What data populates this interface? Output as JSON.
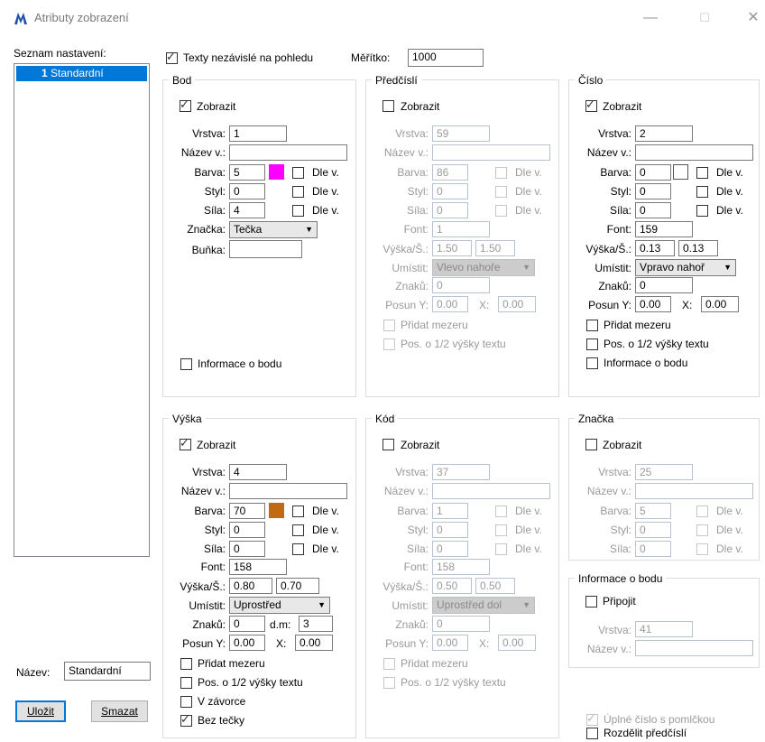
{
  "window": {
    "title": "Atributy zobrazení"
  },
  "left": {
    "list_label": "Seznam nastavení:",
    "list_items": [
      {
        "num": "1",
        "name": "Standardní"
      }
    ],
    "name_label": "Název:",
    "name_value": "Standardní",
    "save": "Uložit",
    "delete": "Smazat"
  },
  "top": {
    "independent_label": "Texty nezávislé na pohledu",
    "independent_checked": true,
    "scale_label": "Měřítko:",
    "scale_value": "1000"
  },
  "labels": {
    "show": "Zobrazit",
    "layer": "Vrstva:",
    "layer_name": "Název v.:",
    "color": "Barva:",
    "style": "Styl:",
    "weight": "Síla:",
    "by_layer": "Dle v.",
    "font": "Font:",
    "height_width": "Výška/Š.:",
    "place": "Umístit:",
    "chars": "Znaků:",
    "offset_y": "Posun Y:",
    "x": "X:",
    "add_space": "Přidat mezeru",
    "half_shift": "Pos. o 1/2 výšky textu",
    "point_info": "Informace o bodu",
    "mark": "Značka:",
    "cell": "Buňka:",
    "dm": "d.m:",
    "brackets": "V závorce",
    "no_dot": "Bez tečky",
    "attach": "Připojit"
  },
  "groups": {
    "bod": {
      "title": "Bod",
      "show": true,
      "layer": "1",
      "layer_name": "",
      "color": "5",
      "color_hex": "#ff00ff",
      "style": "0",
      "weight": "4",
      "mark": "Tečka",
      "cell": "",
      "point_info": false
    },
    "predcisli": {
      "title": "Předčíslí",
      "show": false,
      "layer": "59",
      "layer_name": "",
      "color": "86",
      "style": "0",
      "weight": "0",
      "font": "1",
      "h": "1.50",
      "w": "1.50",
      "place": "Vlevo nahoře",
      "chars": "0",
      "offy": "0.00",
      "offx": "0.00"
    },
    "cislo": {
      "title": "Číslo",
      "show": true,
      "layer": "2",
      "layer_name": "",
      "color": "0",
      "color_hex": "#ffffff",
      "style": "0",
      "weight": "0",
      "font": "159",
      "h": "0.13",
      "w": "0.13",
      "place": "Vpravo nahoř",
      "chars": "0",
      "offy": "0.00",
      "offx": "0.00"
    },
    "vyska": {
      "title": "Výška",
      "show": true,
      "layer": "4",
      "layer_name": "",
      "color": "70",
      "color_hex": "#c06a14",
      "style": "0",
      "weight": "0",
      "font": "158",
      "h": "0.80",
      "w": "0.70",
      "place": "Uprostřed",
      "chars": "0",
      "dm": "3",
      "offy": "0.00",
      "offx": "0.00",
      "no_dot": true
    },
    "kod": {
      "title": "Kód",
      "show": false,
      "layer": "37",
      "layer_name": "",
      "color": "1",
      "style": "0",
      "weight": "0",
      "font": "158",
      "h": "0.50",
      "w": "0.50",
      "place": "Uprostřed dol",
      "chars": "0",
      "offy": "0.00",
      "offx": "0.00"
    },
    "znacka": {
      "title": "Značka",
      "show": false,
      "layer": "25",
      "layer_name": "",
      "color": "5",
      "style": "0",
      "weight": "0"
    },
    "info": {
      "title": "Informace o bodu",
      "attach": false,
      "layer": "41",
      "layer_name": ""
    }
  },
  "bottom": {
    "full_number": "Úplné číslo s pomlčkou",
    "split_prefix": "Rozdělit předčíslí"
  }
}
